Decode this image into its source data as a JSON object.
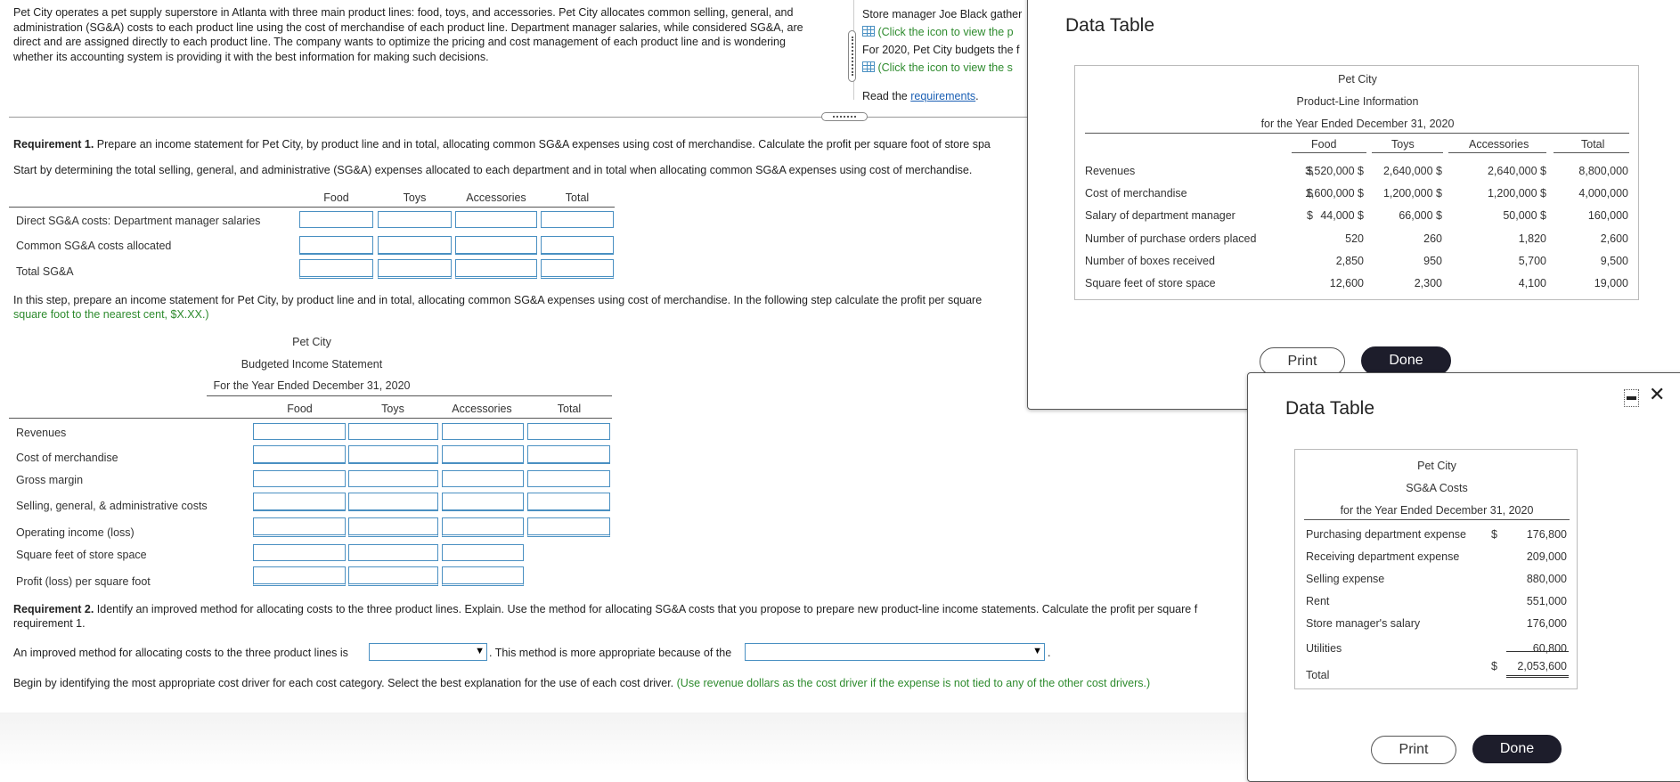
{
  "intro": {
    "line1": "Pet City operates a pet supply superstore in Atlanta with three main product lines: food, toys, and accessories. Pet City allocates common selling, general, and",
    "line2": "administration (SG&A) costs to each product line using the cost of merchandise of each product line. Department manager salaries, while considered SG&A, are",
    "line3": "direct and are assigned directly to each product line. The company wants to optimize the pricing and cost management of each product line and is wondering",
    "line4": "whether its accounting system is providing it with the best information for making such decisions."
  },
  "side_panel": {
    "line1": "Store manager Joe Black gather",
    "link1": "(Click the icon to view the p",
    "line2": "For 2020, Pet City budgets the f",
    "link2": "(Click the icon to view the s",
    "read_prefix": "Read the ",
    "read_link": "requirements",
    "read_suffix": "."
  },
  "req1": {
    "bold": "Requirement 1.",
    "text": " Prepare an income statement for Pet City, by product line and in total, allocating common SG&A expenses using cost of merchandise. Calculate the profit per square foot of store spa",
    "start": "Start by determining the total selling, general, and administrative (SG&A) expenses allocated to each department and in total when allocating common SG&A expenses using cost of merchandise."
  },
  "sga_table": {
    "headers": [
      "Food",
      "Toys",
      "Accessories",
      "Total"
    ],
    "rows": [
      "Direct SG&A costs: Department manager salaries",
      "Common SG&A costs allocated",
      "Total SG&A"
    ]
  },
  "step": {
    "line1": "In this step, prepare an income statement for Pet City, by product line and in total, allocating common SG&A expenses using cost of merchandise. In the following step calculate the profit per square",
    "line2": "square foot to the nearest cent, $X.XX.)"
  },
  "income": {
    "company": "Pet City",
    "title": "Budgeted Income Statement",
    "period": "For the Year Ended December 31, 2020",
    "headers": [
      "Food",
      "Toys",
      "Accessories",
      "Total"
    ],
    "rows": [
      "Revenues",
      "Cost of merchandise",
      "Gross margin",
      "Selling, general, & administrative costs",
      "Operating income (loss)",
      "Square feet of store space",
      "Profit (loss) per square foot"
    ]
  },
  "req2": {
    "bold": "Requirement 2.",
    "text": " Identify an improved method for allocating costs to the three product lines. Explain. Use the method for allocating SG&A costs that you propose to prepare new product-line income statements. Calculate the profit per square f",
    "text2": "requirement 1.",
    "improved_prefix": "An improved method for allocating costs to the three product lines is",
    "improved_mid": ". This method is more appropriate because of the",
    "improved_suffix": ".",
    "begin": "Begin by identifying the most appropriate cost driver for each cost category. Select the best explanation for the use of each cost driver. ",
    "begin_green": "(Use revenue dollars as the cost driver if the expense is not tied to any of the other cost drivers.)"
  },
  "modal1": {
    "title": "Data Table",
    "company": "Pet City",
    "subtitle": "Product-Line Information",
    "period": "for the Year Ended December 31, 2020",
    "headers": [
      "Food",
      "Toys",
      "Accessories",
      "Total"
    ],
    "rows": [
      {
        "label": "Revenues",
        "d": "$",
        "food": "3,520,000 $",
        "toys": "2,640,000 $",
        "acc": "2,640,000 $",
        "total": "8,800,000"
      },
      {
        "label": "Cost of merchandise",
        "d": "$",
        "food": "1,600,000 $",
        "toys": "1,200,000 $",
        "acc": "1,200,000 $",
        "total": "4,000,000"
      },
      {
        "label": "Salary of department manager",
        "d": "$",
        "food": "44,000 $",
        "toys": "66,000 $",
        "acc": "50,000 $",
        "total": "160,000"
      },
      {
        "label": "Number of purchase orders placed",
        "d": "",
        "food": "520",
        "toys": "260",
        "acc": "1,820",
        "total": "2,600"
      },
      {
        "label": "Number of boxes received",
        "d": "",
        "food": "2,850",
        "toys": "950",
        "acc": "5,700",
        "total": "9,500"
      },
      {
        "label": "Square feet of store space",
        "d": "",
        "food": "12,600",
        "toys": "2,300",
        "acc": "4,100",
        "total": "19,000"
      }
    ],
    "print": "Print",
    "done": "Done"
  },
  "modal2": {
    "title": "Data Table",
    "company": "Pet City",
    "subtitle": "SG&A Costs",
    "period": "for the Year Ended December 31, 2020",
    "rows": [
      {
        "label": "Purchasing department expense",
        "d": "$",
        "value": "176,800"
      },
      {
        "label": "Receiving department expense",
        "d": "",
        "value": "209,000"
      },
      {
        "label": "Selling expense",
        "d": "",
        "value": "880,000"
      },
      {
        "label": "Rent",
        "d": "",
        "value": "551,000"
      },
      {
        "label": "Store manager's salary",
        "d": "",
        "value": "176,000"
      },
      {
        "label": "Utilities",
        "d": "",
        "value": "60,800"
      }
    ],
    "total_label": "Total",
    "total_d": "$",
    "total_value": "2,053,600",
    "print": "Print",
    "done": "Done"
  },
  "icons": {
    "minimize": "minimize-icon",
    "close": "close-icon",
    "grid": "table-grid-icon"
  },
  "colors": {
    "field_border": "#4a90c2",
    "green_text": "#2e8b2e",
    "link": "#1a5fb4",
    "done_bg": "#1d1d2b"
  }
}
